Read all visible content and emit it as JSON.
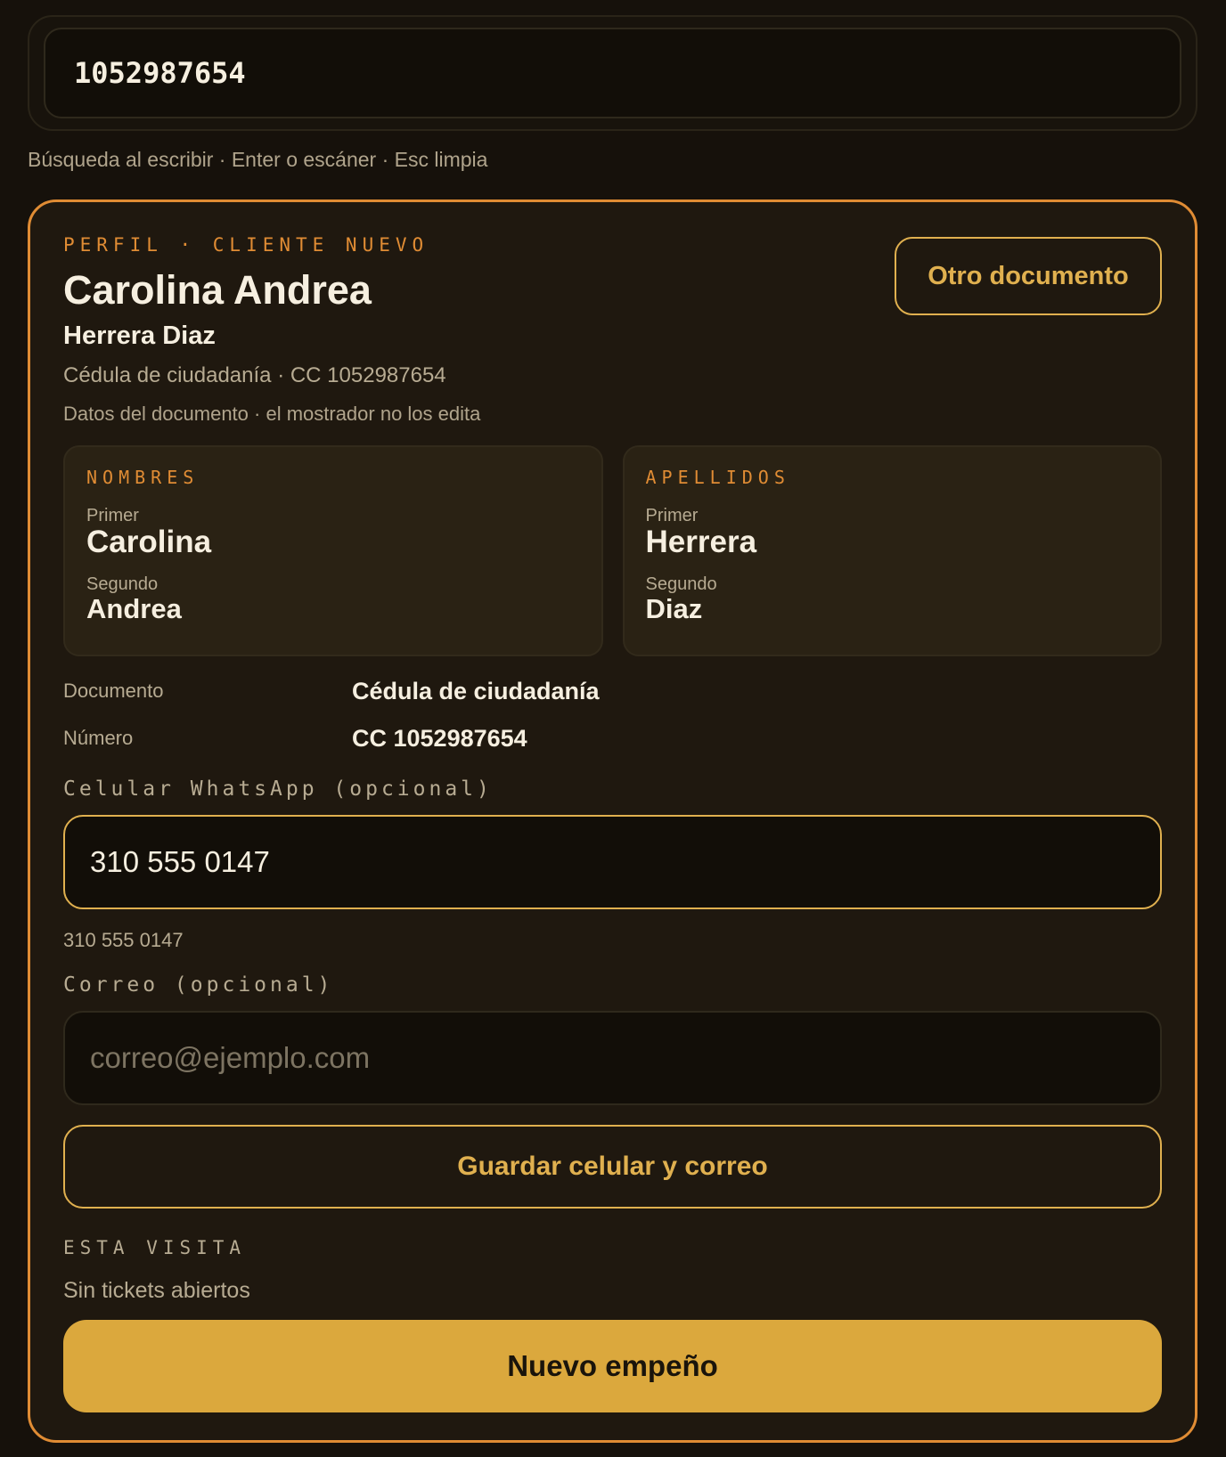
{
  "search": {
    "value": "1052987654",
    "hint": "Búsqueda al escribir · Enter o escáner · Esc limpia"
  },
  "profile": {
    "eyebrow": "PERFIL · CLIENTE NUEVO",
    "full_name": "Carolina Andrea",
    "surname_line": "Herrera Diaz",
    "document_line": "Cédula de ciudadanía · CC 1052987654",
    "note": "Datos del documento · el mostrador no los edita",
    "other_document_label": "Otro documento"
  },
  "names": {
    "title": "NOMBRES",
    "first_label": "Primer",
    "first_value": "Carolina",
    "second_label": "Segundo",
    "second_value": "Andrea"
  },
  "surnames": {
    "title": "APELLIDOS",
    "first_label": "Primer",
    "first_value": "Herrera",
    "second_label": "Segundo",
    "second_value": "Diaz"
  },
  "details": {
    "document_key": "Documento",
    "document_value": "Cédula de ciudadanía",
    "number_key": "Número",
    "number_value": "CC 1052987654"
  },
  "contact": {
    "phone_label": "Celular WhatsApp (opcional)",
    "phone_value": "310 555 0147",
    "phone_echo": "310 555 0147",
    "email_label": "Correo (opcional)",
    "email_value": "",
    "email_placeholder": "correo@ejemplo.com",
    "save_label": "Guardar celular y correo"
  },
  "visit": {
    "label": "ESTA VISITA",
    "status": "Sin tickets abiertos",
    "new_pawn_label": "Nuevo empeño"
  },
  "colors": {
    "accent_orange": "#e08c34",
    "accent_gold": "#dba83d",
    "background": "#16110b"
  }
}
